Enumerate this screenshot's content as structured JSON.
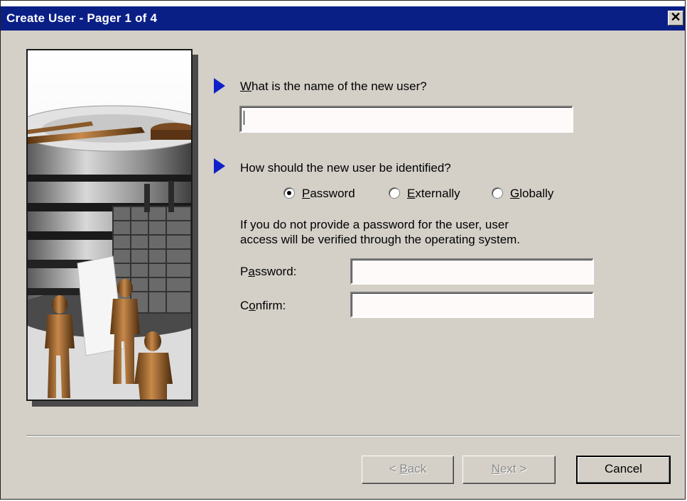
{
  "window": {
    "title": "Create User - Pager 1 of 4",
    "close_glyph": "✕",
    "title_bar_color": "#0a1f86",
    "face_color": "#d4d0c8"
  },
  "picture": {
    "icon": "database-server-illustration"
  },
  "name_question": {
    "pointer_icon": "blue-arrow-pointer",
    "label_accel": "W",
    "label_rest": "hat is the name of the new user?",
    "value": ""
  },
  "identify_question": {
    "pointer_icon": "blue-arrow-pointer",
    "label": "How should the new user be identified?",
    "options": [
      {
        "accel": "P",
        "rest": "assword",
        "selected": true
      },
      {
        "accel": "E",
        "rest": "xternally",
        "selected": false
      },
      {
        "accel": "G",
        "rest": "lobally",
        "selected": false
      }
    ]
  },
  "info_text": {
    "line1": "If you do not provide a password for the user, user",
    "line2": "access will be verified through the operating system."
  },
  "password_field": {
    "label_pre": "P",
    "label_accel": "a",
    "label_post": "ssword:",
    "value": ""
  },
  "confirm_field": {
    "label_pre": "C",
    "label_accel": "o",
    "label_post": "nfirm:",
    "value": ""
  },
  "buttons": {
    "back": {
      "pre": "< ",
      "accel": "B",
      "post": "ack",
      "enabled": false
    },
    "next": {
      "pre": "",
      "accel": "N",
      "post": "ext >",
      "enabled": false
    },
    "cancel": {
      "label": "Cancel",
      "enabled": true
    }
  }
}
